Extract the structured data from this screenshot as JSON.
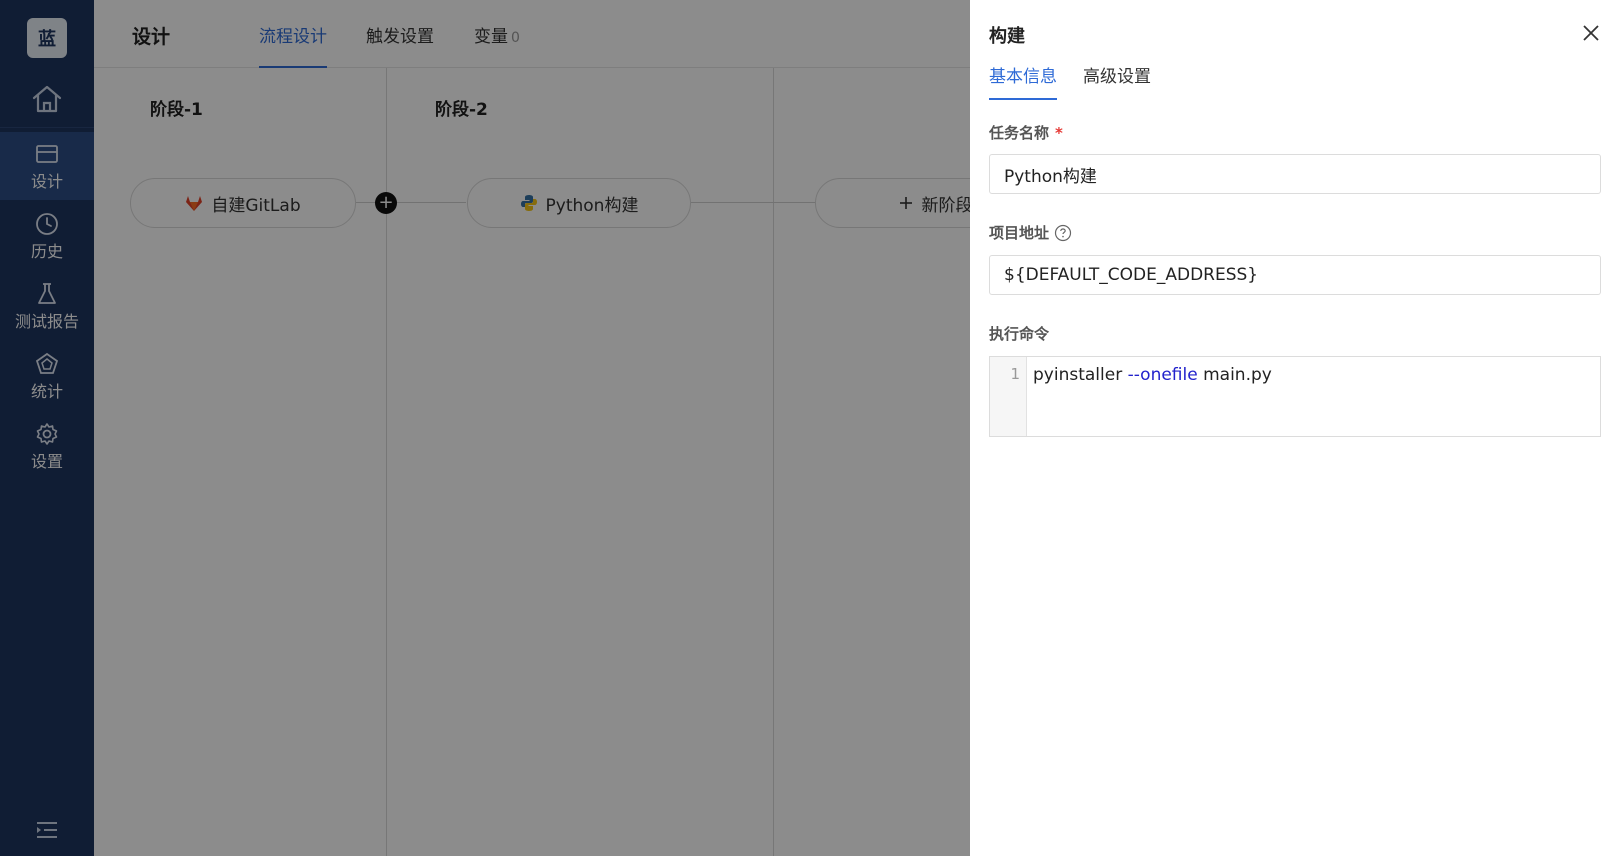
{
  "sidebar": {
    "logo": "蓝",
    "items": [
      {
        "label": "设计",
        "icon": "design-icon",
        "active": true
      },
      {
        "label": "历史",
        "icon": "clock-icon",
        "active": false
      },
      {
        "label": "测试报告",
        "icon": "flask-icon",
        "active": false
      },
      {
        "label": "统计",
        "icon": "pentagon-chart-icon",
        "active": false
      },
      {
        "label": "设置",
        "icon": "gear-icon",
        "active": false
      }
    ]
  },
  "header": {
    "title": "设计",
    "tabs": [
      {
        "label": "流程设计",
        "active": true
      },
      {
        "label": "触发设置",
        "active": false
      },
      {
        "label": "变量",
        "count": "0",
        "active": false
      }
    ]
  },
  "pipeline": {
    "stages": [
      {
        "title": "阶段-1",
        "node": "自建GitLab",
        "icon": "gitlab-icon"
      },
      {
        "title": "阶段-2",
        "node": "Python构建",
        "icon": "python-icon"
      }
    ],
    "new_stage_label": "新阶段"
  },
  "drawer": {
    "title": "构建",
    "tabs": [
      {
        "label": "基本信息",
        "active": true
      },
      {
        "label": "高级设置",
        "active": false
      }
    ],
    "task_name": {
      "label": "任务名称",
      "required_mark": "*",
      "value": "Python构建"
    },
    "project_address": {
      "label": "项目地址",
      "value": "${DEFAULT_CODE_ADDRESS}"
    },
    "command": {
      "label": "执行命令",
      "line_number": "1",
      "code_prefix": "pyinstaller ",
      "code_flag": "--onefile",
      "code_suffix": " main.py"
    }
  },
  "colors": {
    "sidebar_bg": "#1e3560",
    "sidebar_active": "#2c4d86",
    "accent": "#2e6ad6",
    "required": "#e53935"
  }
}
